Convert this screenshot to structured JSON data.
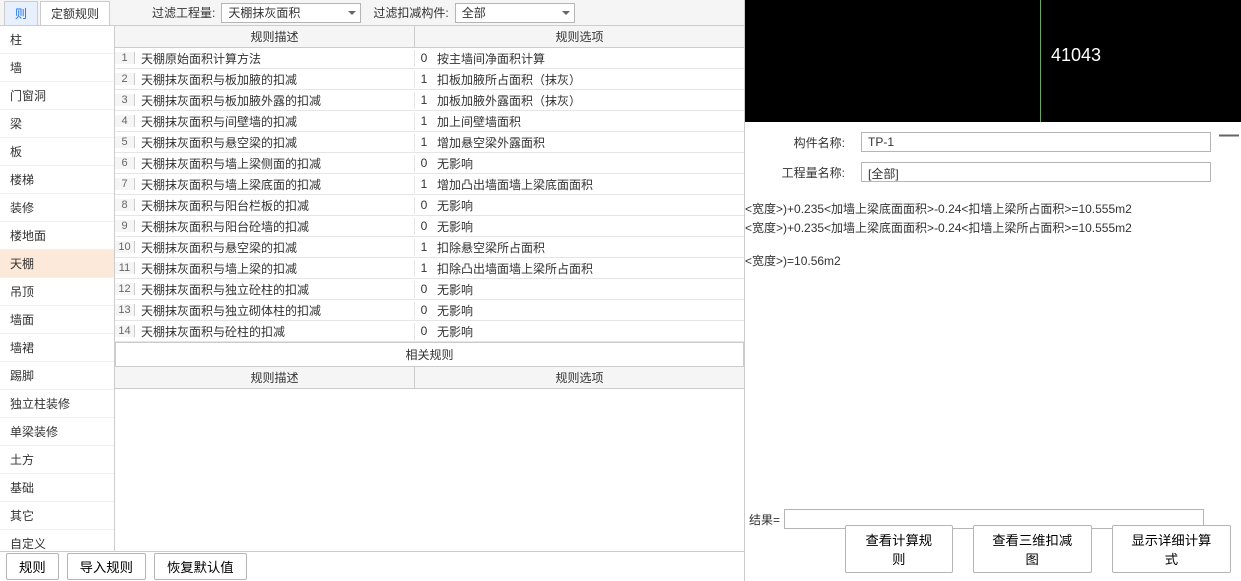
{
  "tabs": {
    "tab1": "则",
    "tab2": "定额规则"
  },
  "filters": {
    "qty_label": "过滤工程量:",
    "qty_value": "天棚抹灰面积",
    "comp_label": "过滤扣减构件:",
    "comp_value": "全部"
  },
  "sidebar": {
    "items": [
      "柱",
      "墙",
      "门窗洞",
      "梁",
      "板",
      "楼梯",
      "装修",
      "楼地面",
      "天棚",
      "吊顶",
      "墙面",
      "墙裙",
      "踢脚",
      "独立柱装修",
      "单梁装修",
      "土方",
      "基础",
      "其它",
      "自定义"
    ],
    "active_index": 8
  },
  "table_headers": {
    "desc": "规则描述",
    "opt": "规则选项"
  },
  "rules": [
    {
      "n": "1",
      "desc": "天棚原始面积计算方法",
      "code": "0",
      "opt": "按主墙间净面积计算"
    },
    {
      "n": "2",
      "desc": "天棚抹灰面积与板加腋的扣减",
      "code": "1",
      "opt": "扣板加腋所占面积（抹灰）"
    },
    {
      "n": "3",
      "desc": "天棚抹灰面积与板加腋外露的扣减",
      "code": "1",
      "opt": "加板加腋外露面积（抹灰）"
    },
    {
      "n": "4",
      "desc": "天棚抹灰面积与间壁墙的扣减",
      "code": "1",
      "opt": "加上间壁墙面积"
    },
    {
      "n": "5",
      "desc": "天棚抹灰面积与悬空梁的扣减",
      "code": "1",
      "opt": "增加悬空梁外露面积"
    },
    {
      "n": "6",
      "desc": "天棚抹灰面积与墙上梁侧面的扣减",
      "code": "0",
      "opt": "无影响"
    },
    {
      "n": "7",
      "desc": "天棚抹灰面积与墙上梁底面的扣减",
      "code": "1",
      "opt": "增加凸出墙面墙上梁底面面积"
    },
    {
      "n": "8",
      "desc": "天棚抹灰面积与阳台栏板的扣减",
      "code": "0",
      "opt": "无影响"
    },
    {
      "n": "9",
      "desc": "天棚抹灰面积与阳台砼墙的扣减",
      "code": "0",
      "opt": "无影响"
    },
    {
      "n": "10",
      "desc": "天棚抹灰面积与悬空梁的扣减",
      "code": "1",
      "opt": "扣除悬空梁所占面积"
    },
    {
      "n": "11",
      "desc": "天棚抹灰面积与墙上梁的扣减",
      "code": "1",
      "opt": "扣除凸出墙面墙上梁所占面积"
    },
    {
      "n": "12",
      "desc": "天棚抹灰面积与独立砼柱的扣减",
      "code": "0",
      "opt": "无影响"
    },
    {
      "n": "13",
      "desc": "天棚抹灰面积与独立砌体柱的扣减",
      "code": "0",
      "opt": "无影响"
    },
    {
      "n": "14",
      "desc": "天棚抹灰面积与砼柱的扣减",
      "code": "0",
      "opt": "无影响"
    }
  ],
  "related_header": "相关规则",
  "bottom_buttons": {
    "b1": "规则",
    "b2": "导入规则",
    "b3": "恢复默认值"
  },
  "viewport_text": "41043",
  "details": {
    "comp_name_label": "构件名称:",
    "comp_name_value": "TP-1",
    "qty_name_label": "工程量名称:",
    "qty_name_value": "[全部]"
  },
  "formulas": {
    "l1": "<宽度>)+0.235<加墙上梁底面面积>-0.24<扣墙上梁所占面积>=10.555m2",
    "l2": "<宽度>)+0.235<加墙上梁底面面积>-0.24<扣墙上梁所占面积>=10.555m2",
    "l3": "<宽度>)=10.56m2"
  },
  "result_label": "结果=",
  "right_buttons": {
    "b1": "查看计算规则",
    "b2": "查看三维扣减图",
    "b3": "显示详细计算式"
  }
}
